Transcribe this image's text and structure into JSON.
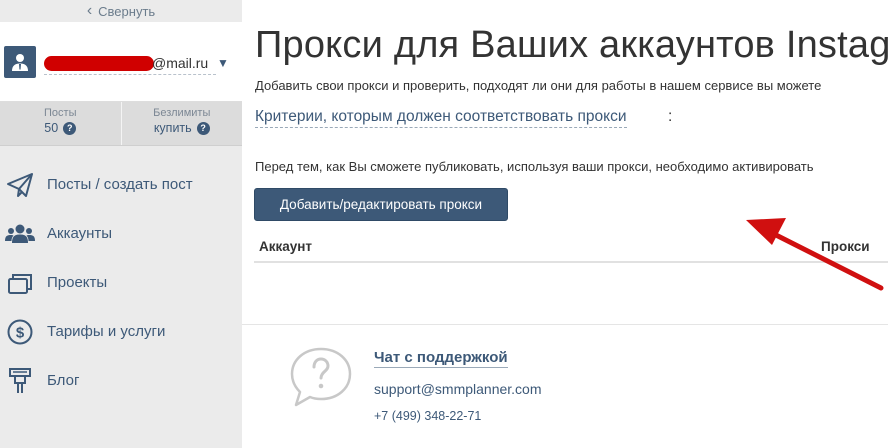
{
  "sidebar": {
    "collapse_label": "Свернуть",
    "user": {
      "email_domain": "@mail.ru"
    },
    "stats": [
      {
        "label": "Посты",
        "value": "50"
      },
      {
        "label": "Безлимиты",
        "value": "купить"
      }
    ],
    "nav": [
      {
        "label": "Посты / создать пост",
        "icon": "paper-plane-icon"
      },
      {
        "label": "Аккаунты",
        "icon": "users-icon"
      },
      {
        "label": "Проекты",
        "icon": "folders-icon"
      },
      {
        "label": "Тарифы и услуги",
        "icon": "dollar-icon"
      },
      {
        "label": "Блог",
        "icon": "megaphone-icon"
      }
    ]
  },
  "main": {
    "title": "Прокси для Ваших аккаунтов Instagram",
    "subtitle": "Добавить свои прокси и проверить, подходят ли они для работы в нашем сервисе вы можете",
    "criteria_link": "Критерии, которым должен соответствовать прокси",
    "criteria_colon": ":",
    "notice": "Перед тем, как Вы сможете публиковать, используя ваши прокси, необходимо активировать",
    "add_button": "Добавить/редактировать прокси",
    "table": {
      "col_account": "Аккаунт",
      "col_proxy": "Прокси"
    }
  },
  "footer": {
    "support_title": "Чат с поддержкой",
    "support_email": "support@smmplanner.com",
    "support_phone": "+7 (499) 348-22-71"
  },
  "colors": {
    "brand": "#3d5978",
    "sidebar_bg": "#ebebeb",
    "annotation_arrow": "#d01010"
  }
}
